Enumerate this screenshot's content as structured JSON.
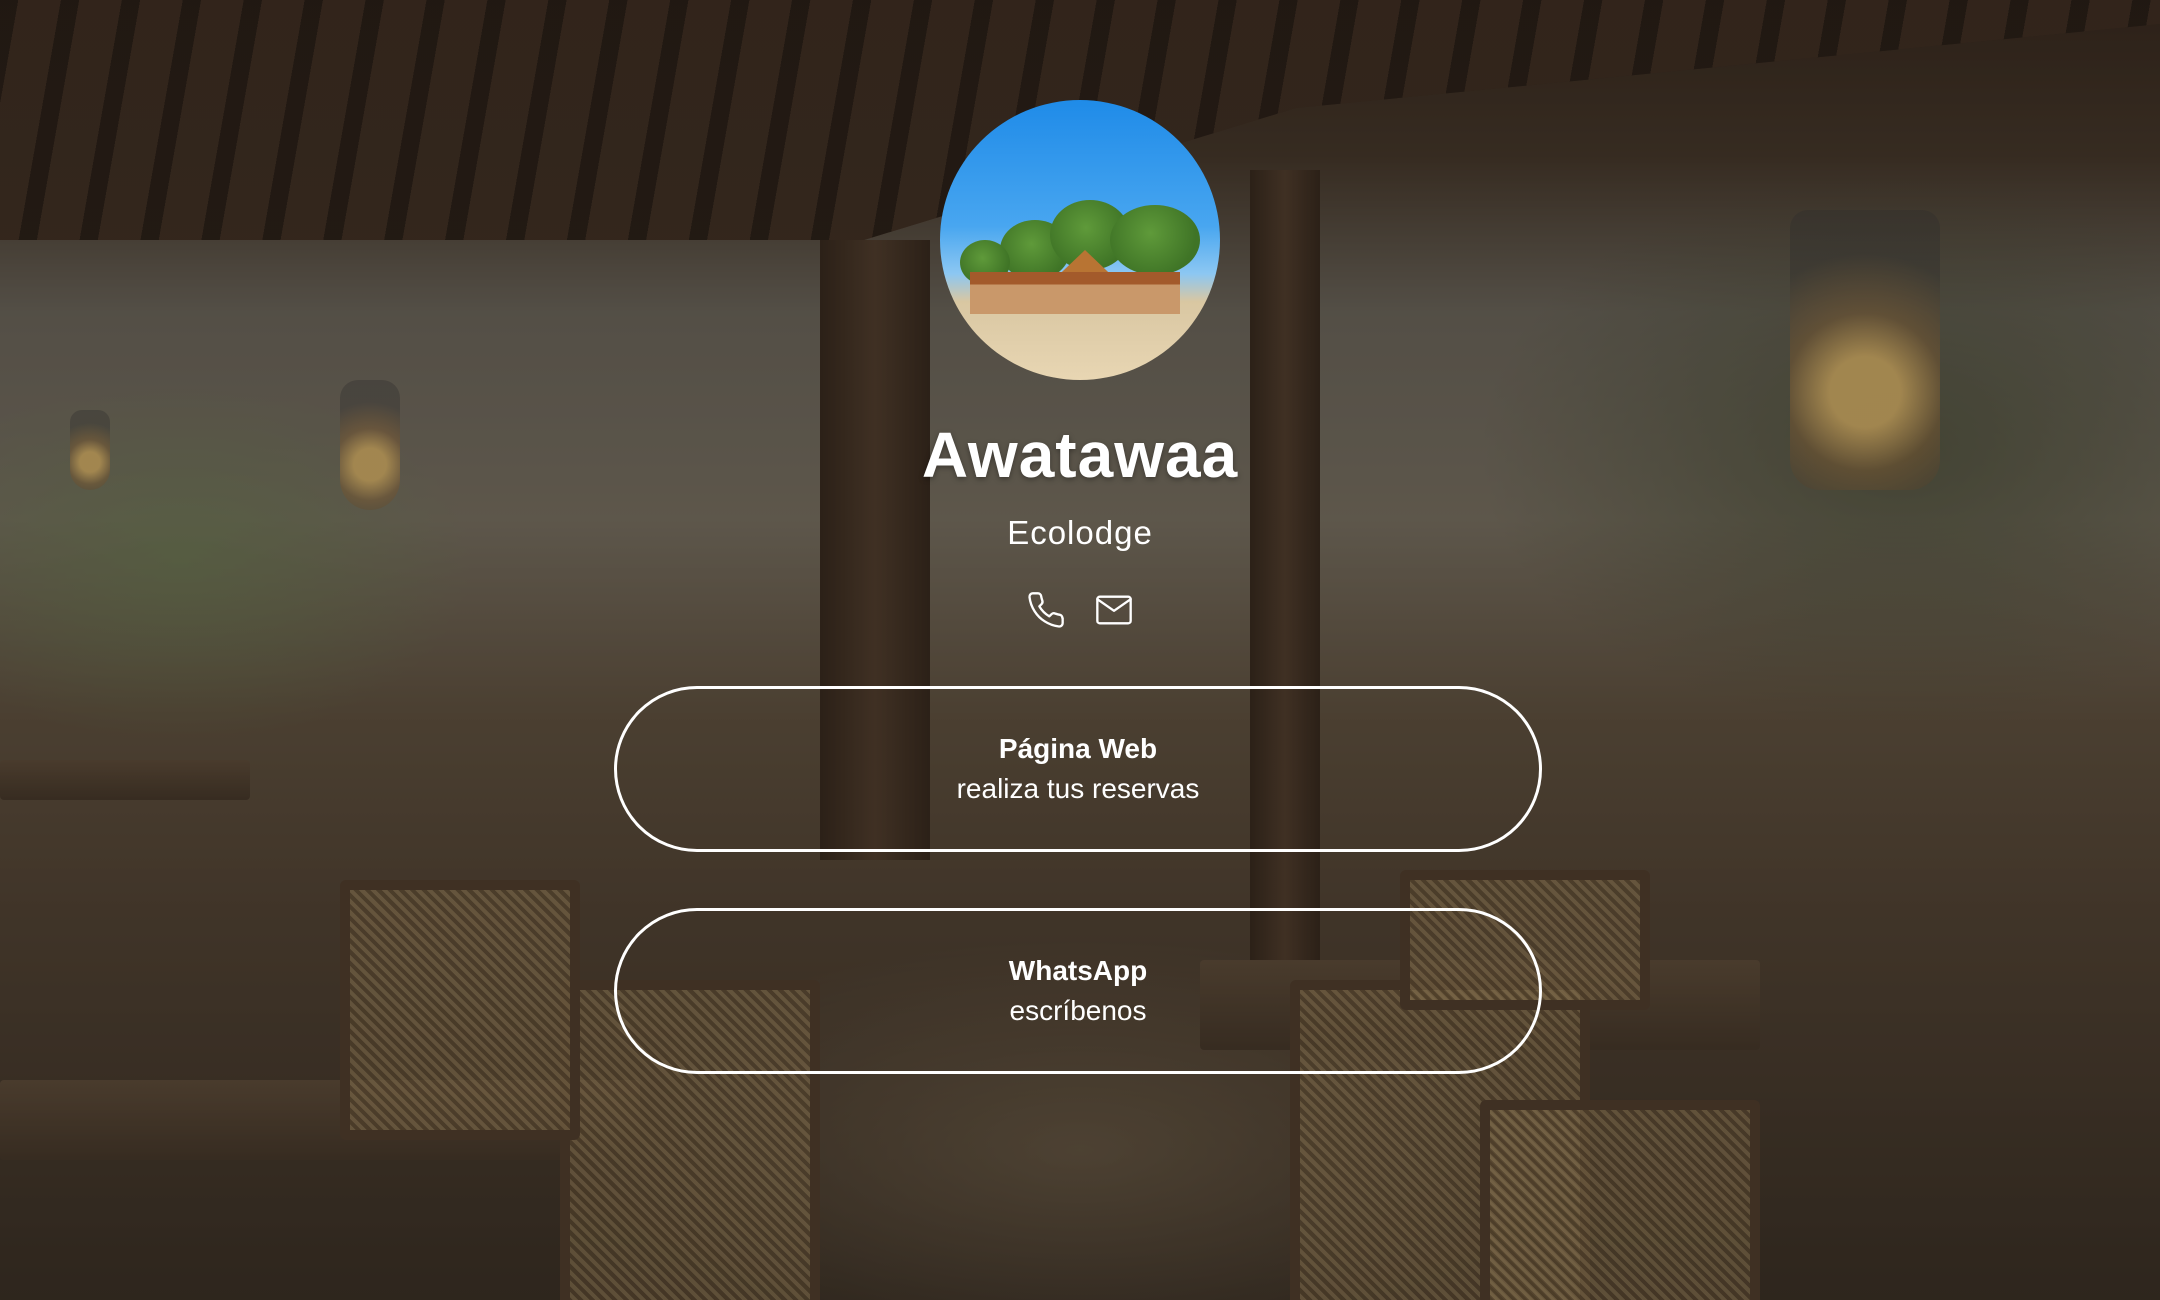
{
  "profile": {
    "name": "Awatawaa",
    "tagline": "Ecolodge"
  },
  "contact": {
    "phone_icon": "phone-icon",
    "email_icon": "mail-icon"
  },
  "links": [
    {
      "label": "Página Web",
      "sub": "realiza tus reservas"
    },
    {
      "label": "WhatsApp",
      "sub": "escríbenos"
    }
  ],
  "colors": {
    "text": "#ffffff",
    "button_border": "#ffffff",
    "overlay": "#141210"
  }
}
